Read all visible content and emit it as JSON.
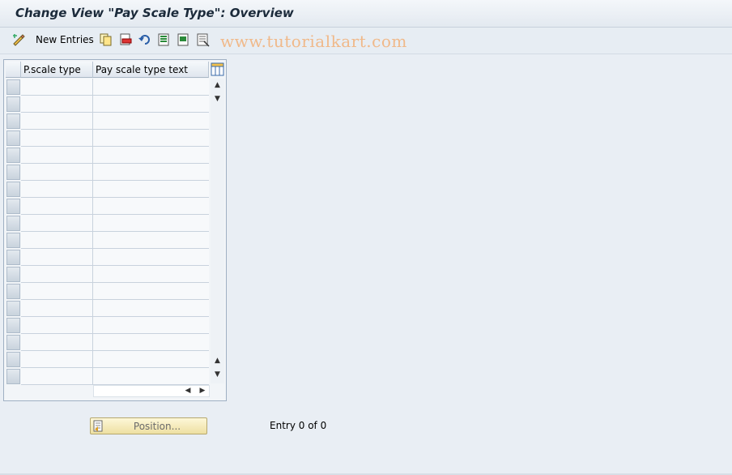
{
  "title": "Change View \"Pay Scale Type\": Overview",
  "toolbar": {
    "new_entries_label": "New Entries",
    "icons": [
      "edit-pencil-icon",
      "copy-icon",
      "delete-icon",
      "undo-icon",
      "select-all-icon",
      "select-block-icon",
      "deselect-all-icon"
    ]
  },
  "watermark": "www.tutorialkart.com",
  "table": {
    "columns": [
      "P.scale type",
      "Pay scale type text"
    ],
    "row_count": 18,
    "rows": []
  },
  "position_button_label": "Position...",
  "entry_status": "Entry 0 of 0"
}
